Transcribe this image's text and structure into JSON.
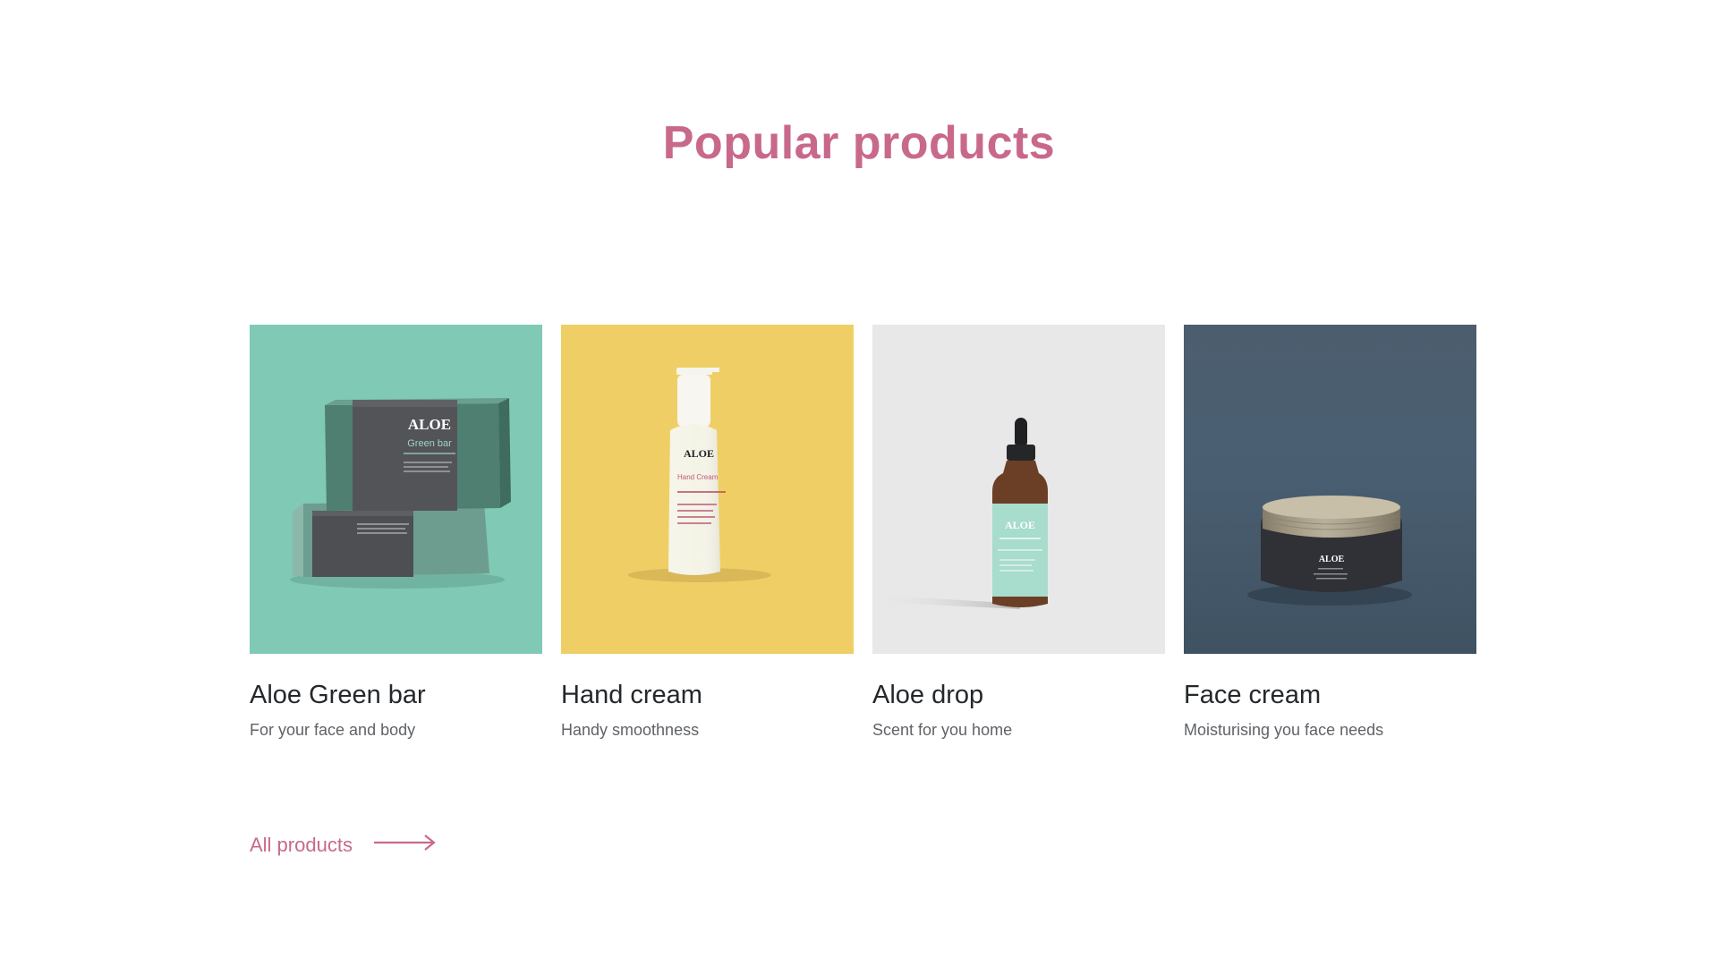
{
  "section": {
    "title": "Popular products"
  },
  "products": [
    {
      "name": "Aloe Green bar",
      "description": "For your face and body",
      "brand": "ALOE",
      "label": "Green bar",
      "bg_color": "#80c9b5"
    },
    {
      "name": "Hand cream",
      "description": "Handy smoothness",
      "brand": "ALOE",
      "label": "Hand Cream",
      "bg_color": "#efcf65"
    },
    {
      "name": "Aloe drop",
      "description": "Scent for you home",
      "brand": "ALOE",
      "bg_color": "#e8e8e8"
    },
    {
      "name": "Face cream",
      "description": "Moisturising you face needs",
      "brand": "ALOE",
      "bg_color": "#4a5f72"
    }
  ],
  "link": {
    "label": "All products",
    "arrow_icon": "arrow-right-icon"
  },
  "colors": {
    "accent": "#c8698c",
    "text": "#25282b",
    "muted": "#5f6267"
  }
}
